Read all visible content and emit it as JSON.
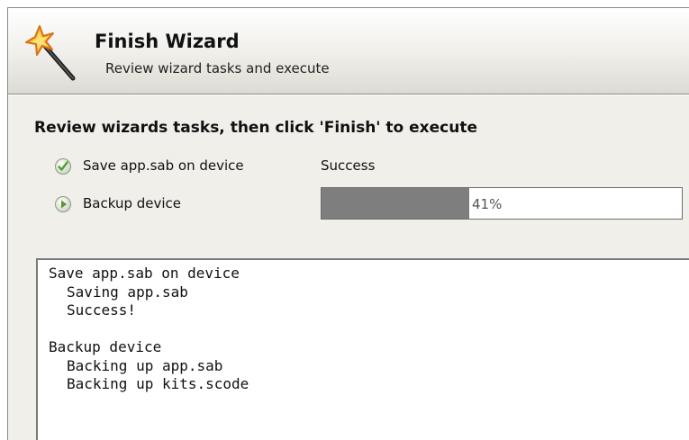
{
  "header": {
    "title": "Finish Wizard",
    "subtitle": "Review wizard tasks and execute",
    "icon": "magic-wand-icon"
  },
  "instructions": "Review wizards tasks, then click 'Finish' to execute",
  "tasks": [
    {
      "label": "Save app.sab on device",
      "status": "Success",
      "icon": "check-circle-icon",
      "icon_color": "#5cae3a"
    },
    {
      "label": "Backup device",
      "progress_text": "41%",
      "progress_percent": 41,
      "icon": "play-circle-icon",
      "icon_color": "#6a9a3a"
    }
  ],
  "log": [
    {
      "text": "Save app.sab on device",
      "indent": false
    },
    {
      "text": "Saving app.sab",
      "indent": true
    },
    {
      "text": "Success!",
      "indent": true
    },
    {
      "text": "",
      "indent": false
    },
    {
      "text": "Backup device",
      "indent": false
    },
    {
      "text": "Backing up app.sab",
      "indent": true
    },
    {
      "text": "Backing up kits.scode",
      "indent": true
    }
  ],
  "colors": {
    "progress_fill": "#7e7e7e",
    "header_border": "#8e8d86",
    "panel_background": "#f0efea"
  }
}
